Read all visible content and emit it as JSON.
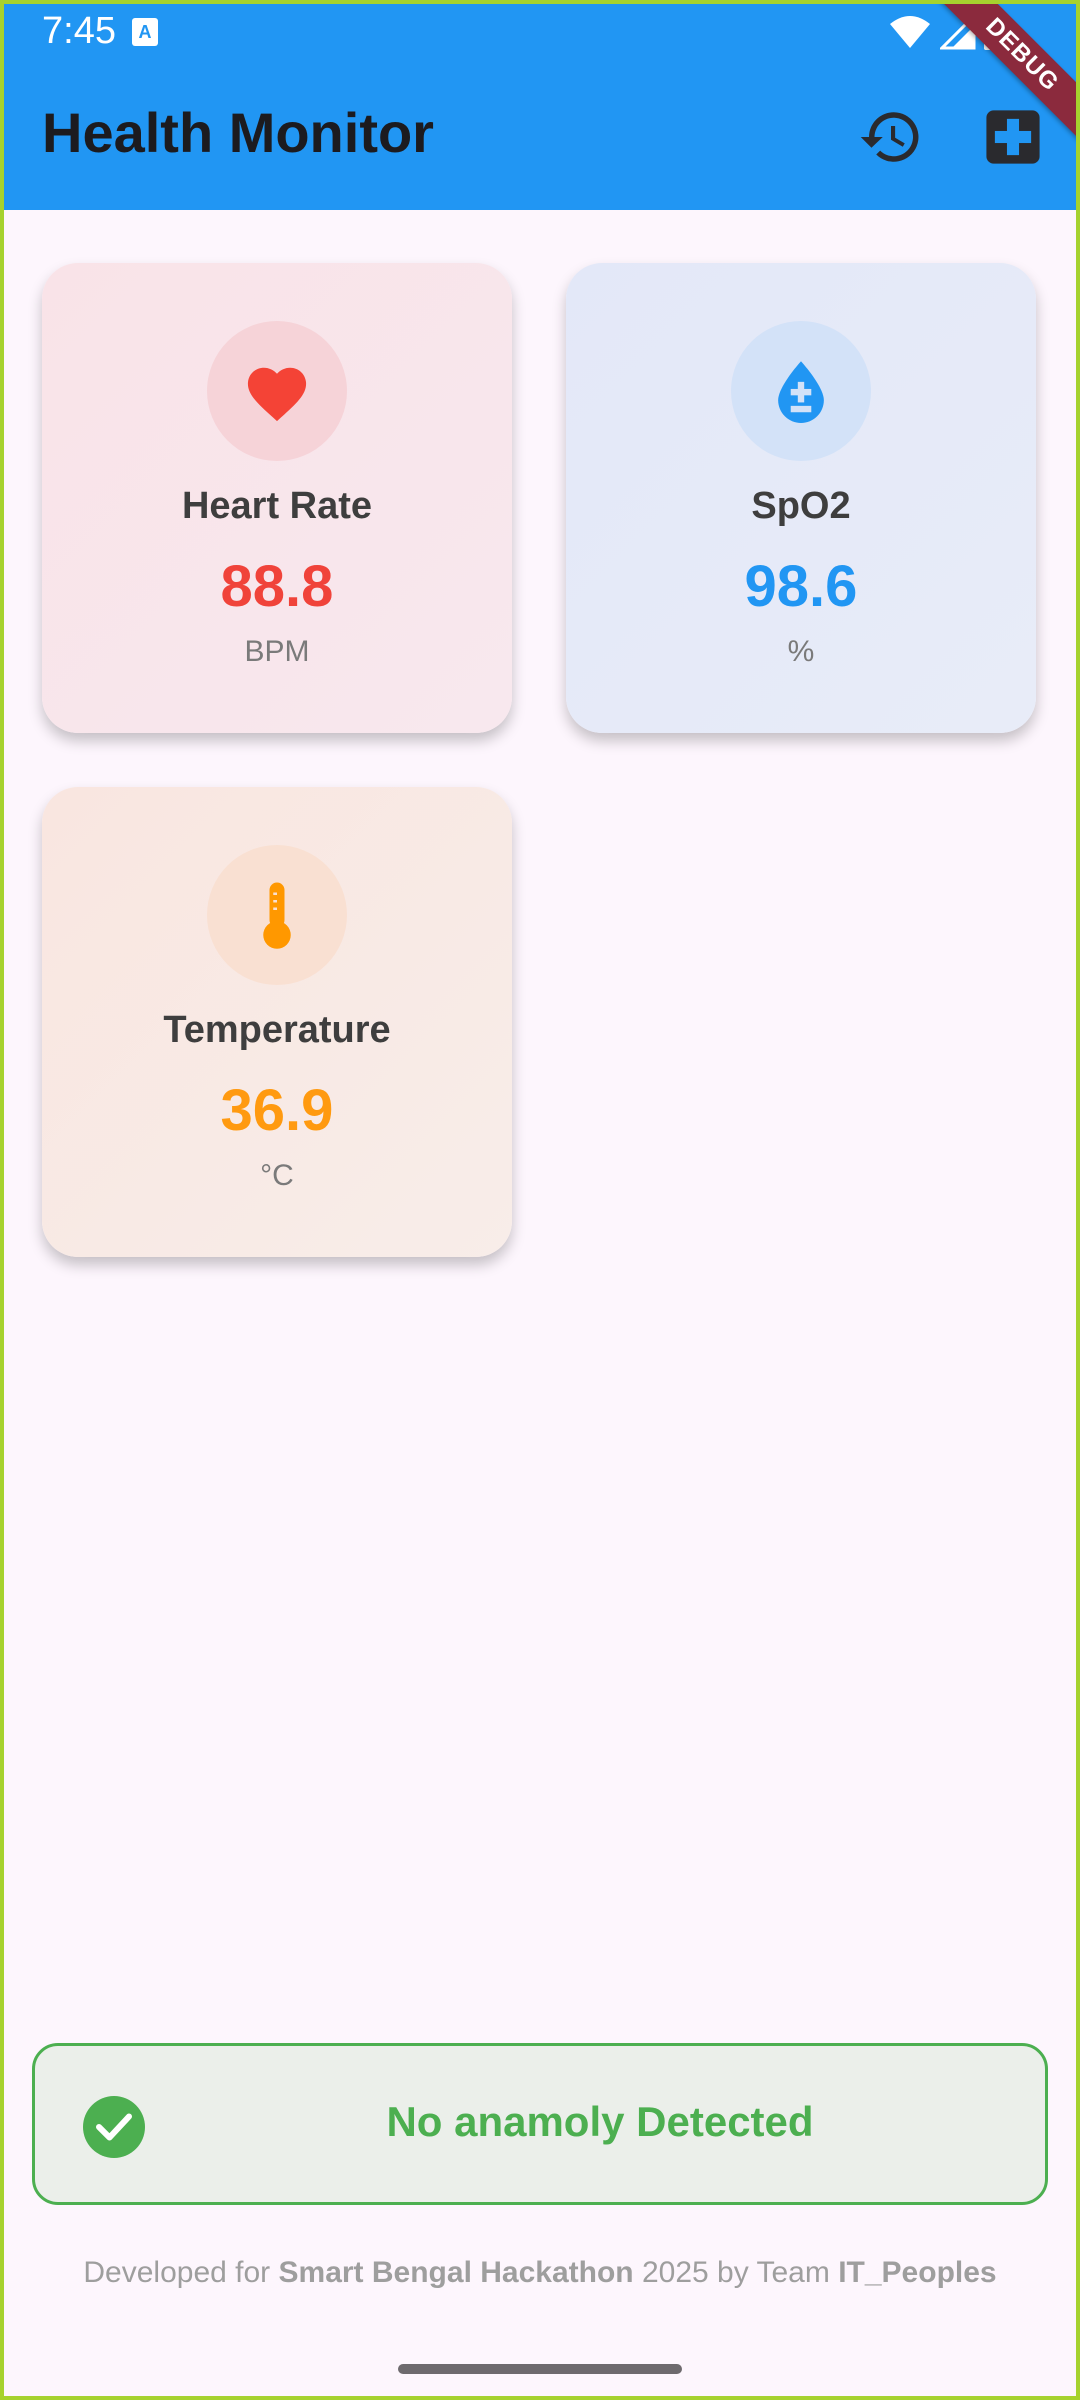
{
  "status_bar": {
    "time": "7:45",
    "notification_icon": "a-icon"
  },
  "debug_ribbon": "DEBUG",
  "app_bar": {
    "title": "Health Monitor",
    "actions": [
      "history-icon",
      "medical-add-icon"
    ],
    "color": "#2196f3"
  },
  "cards": [
    {
      "label": "Heart Rate",
      "value": "88.8",
      "unit": "BPM",
      "icon": "heart-icon",
      "color": "#f0433a"
    },
    {
      "label": "SpO2",
      "value": "98.6",
      "unit": "%",
      "icon": "water-drop-icon",
      "color": "#2196f3"
    },
    {
      "label": "Temperature",
      "value": "36.9",
      "unit": "°C",
      "icon": "thermometer-icon",
      "color": "#ff9a10"
    }
  ],
  "status_banner": {
    "text": "No anamoly Detected",
    "icon": "check-circle-icon",
    "color": "#4caf50"
  },
  "footer": {
    "prefix": "Developed for ",
    "event": "Smart Bengal Hackathon",
    "middle": " 2025 by Team ",
    "team": "IT_Peoples"
  }
}
